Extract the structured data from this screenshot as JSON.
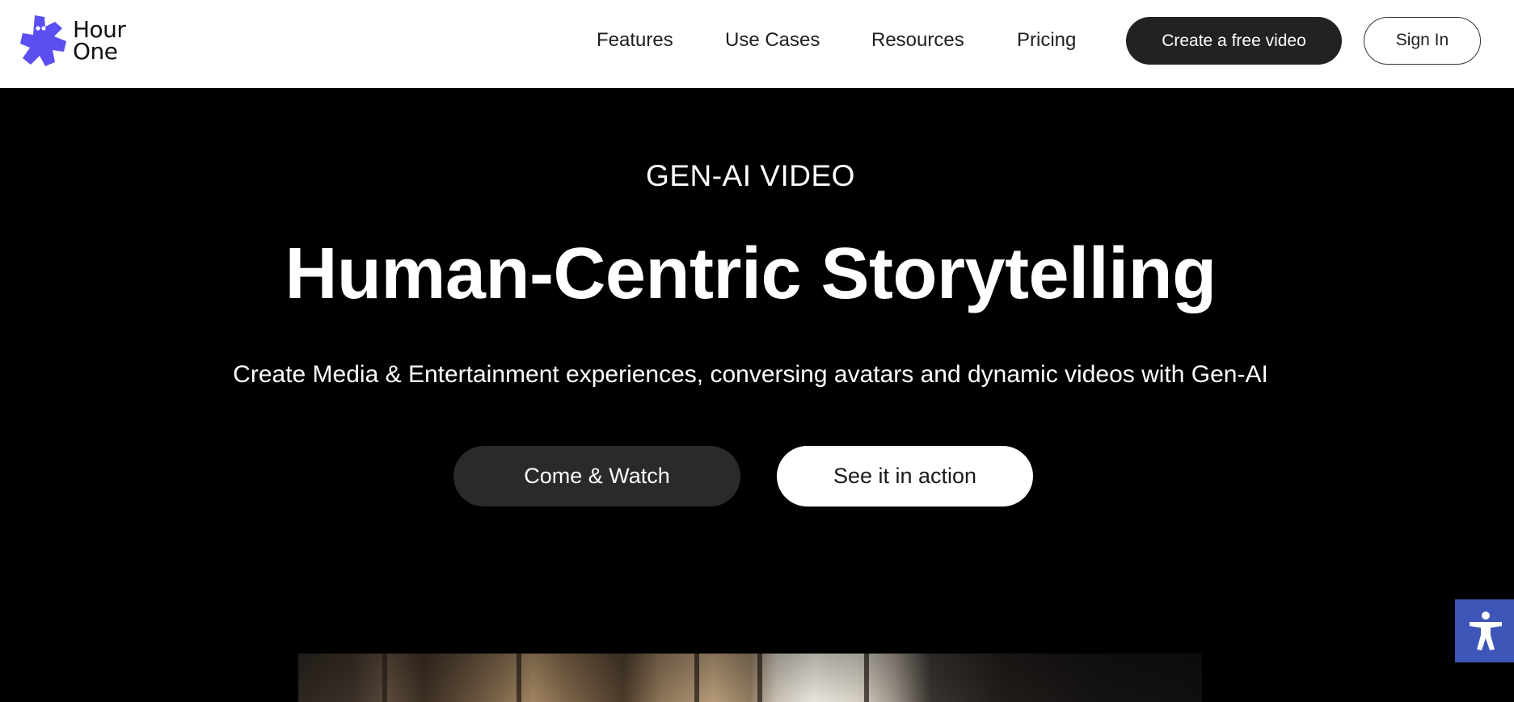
{
  "header": {
    "logo": {
      "line1": "Hour",
      "line2": "One",
      "color": "#5b4ff2"
    },
    "nav": [
      {
        "label": "Features"
      },
      {
        "label": "Use Cases"
      },
      {
        "label": "Resources"
      },
      {
        "label": "Pricing"
      }
    ],
    "cta_label": "Create a free video",
    "signin_label": "Sign In"
  },
  "hero": {
    "eyebrow": "GEN-AI VIDEO",
    "headline": "Human-Centric Storytelling",
    "subhead": "Create Media & Entertainment experiences, conversing avatars and dynamic videos with Gen-AI",
    "primary_button": "Come & Watch",
    "secondary_button": "See it in action"
  },
  "accessibility": {
    "icon": "accessibility-icon",
    "color": "#3e56b8"
  }
}
